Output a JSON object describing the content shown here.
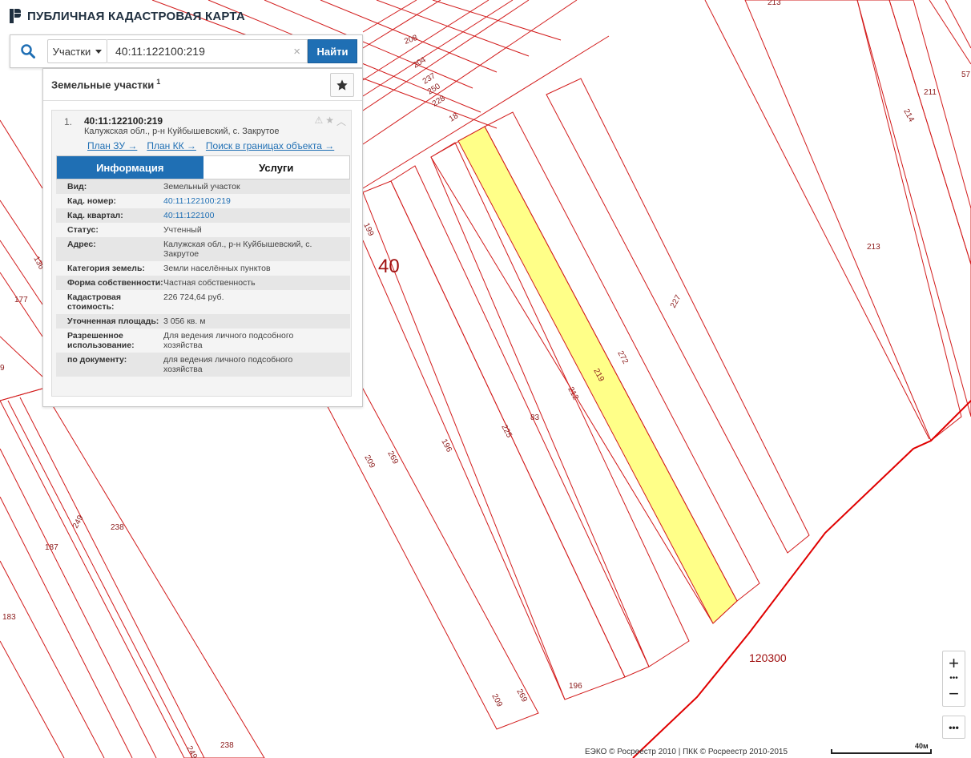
{
  "header": {
    "title": "ПУБЛИЧНАЯ КАДАСТРОВАЯ КАРТА"
  },
  "search": {
    "type_select": "Участки",
    "query": "40:11:122100:219",
    "find_label": "Найти"
  },
  "results": {
    "title": "Земельные участки",
    "count": "1",
    "item": {
      "index": "1.",
      "cad_number": "40:11:122100:219",
      "address": "Калужская обл., р-н Куйбышевский, с. Закрутое",
      "links": [
        "План ЗУ →",
        "План КК →",
        "Поиск в границах объекта →"
      ],
      "tabs": [
        "Информация",
        "Услуги"
      ],
      "info": [
        {
          "key": "Вид:",
          "value": "Земельный участок"
        },
        {
          "key": "Кад. номер:",
          "value": "40:11:122100:219"
        },
        {
          "key": "Кад. квартал:",
          "value": "40:11:122100"
        },
        {
          "key": "Статус:",
          "value": "Учтенный"
        },
        {
          "key": "Адрес:",
          "value": "Калужская обл., р-н Куйбышевский, с. Закрутое"
        },
        {
          "key": "Категория земель:",
          "value": "Земли населённых пунктов"
        },
        {
          "key": "Форма собственности:",
          "value": "Частная собственность"
        },
        {
          "key": "Кадастровая стоимость:",
          "value": "226 724,64 руб."
        },
        {
          "key": "Уточненная площадь:",
          "value": "3 056 кв. м"
        },
        {
          "key": "Разрешенное использование:",
          "value": "Для ведения личного подсобного хозяйства"
        },
        {
          "key": "по документу:",
          "value": "для ведения личного подсобного хозяйства"
        }
      ]
    }
  },
  "map": {
    "highlight_color": "#ffff88",
    "boundary_color": "#e00000",
    "block_label_40": "40",
    "block_label_120300": "120300",
    "plot_labels": [
      "213",
      "208",
      "204",
      "237",
      "250",
      "228",
      "18",
      "214",
      "211",
      "57",
      "213",
      "199",
      "227",
      "272",
      "219",
      "212",
      "83",
      "225",
      "196",
      "209",
      "269",
      "177",
      "136",
      "238",
      "187",
      "249",
      "183",
      "196",
      "209",
      "269",
      "238",
      "249",
      "187"
    ]
  },
  "controls": {
    "zoom_in": "+",
    "zoom_out": "−",
    "dots": "•••",
    "more": "•••"
  },
  "footer": {
    "attribution": "ЕЭКО © Росреестр 2010 | ПКК © Росреестр 2010-2015",
    "scale": "40м"
  }
}
